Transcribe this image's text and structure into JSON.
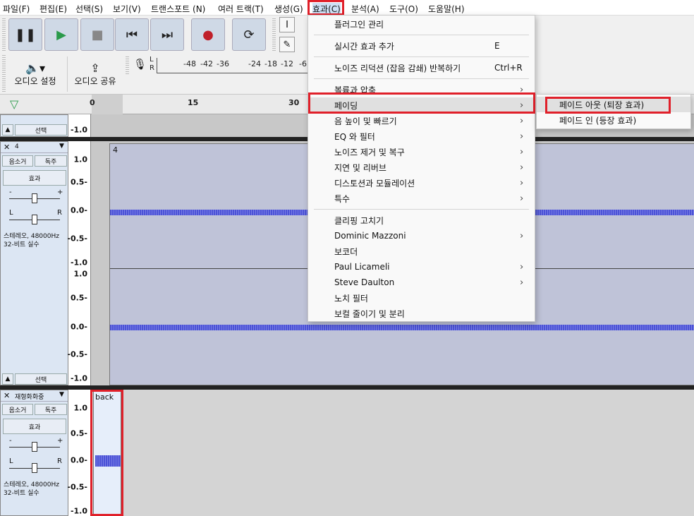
{
  "menubar": {
    "items": [
      "파일(F)",
      "편집(E)",
      "선택(S)",
      "보기(V)",
      "트랜스포트 (N)",
      "여러 트랙(T)",
      "생성(G)",
      "효과(C)",
      "분석(A)",
      "도구(O)",
      "도움말(H)"
    ]
  },
  "toolbar": {
    "pause_icon": "pause-icon",
    "play_icon": "play-icon",
    "stop_icon": "stop-icon",
    "skip_start_icon": "skip-start-icon",
    "skip_end_icon": "skip-end-icon",
    "record_icon": "record-icon",
    "loop_icon": "loop-icon",
    "audio_setup_label": "오디오 설정",
    "audio_share_label": "오디오 공유",
    "meter_ticks": [
      "-48",
      "-42",
      "-36",
      "-24",
      "-18",
      "-12",
      "-6"
    ],
    "meter_lr": [
      "L",
      "R"
    ]
  },
  "timeline": {
    "ticks": [
      "0",
      "15",
      "30"
    ]
  },
  "track1": {
    "name": "4",
    "mute": "음소거",
    "solo": "독주",
    "effects": "효과",
    "pan_l": "L",
    "pan_r": "R",
    "gain_minus": "-",
    "gain_plus": "+",
    "info_line1": "스테레오, 48000Hz",
    "info_line2": "32-비트 실수",
    "select": "선택",
    "clip_name": "4",
    "scale": [
      "1.0",
      "0.5-",
      "0.0-",
      "-0.5-",
      "-1.0"
    ]
  },
  "track_top": {
    "select": "선택",
    "scale_bottom": "-1.0"
  },
  "track2": {
    "name": "재형화화중",
    "mute": "음소거",
    "solo": "독주",
    "effects": "효과",
    "pan_l": "L",
    "pan_r": "R",
    "gain_minus": "-",
    "gain_plus": "+",
    "info_line1": "스테레오, 48000Hz",
    "info_line2": "32-비트 실수",
    "clip_name": "back",
    "scale": [
      "1.0",
      "0.5-",
      "0.0-",
      "-0.5-",
      "-1.0"
    ]
  },
  "effects_menu": {
    "items": [
      {
        "label": "플러그인 관리",
        "shortcut": "",
        "arrow": ""
      },
      {
        "label": "실시간 효과 추가",
        "shortcut": "E",
        "arrow": ""
      },
      {
        "label": "노이즈 리덕션 (잡음 감쇄) 반복하기",
        "shortcut": "Ctrl+R",
        "arrow": ""
      },
      {
        "label": "볼륨과 압축",
        "shortcut": "",
        "arrow": "›"
      },
      {
        "label": "페이딩",
        "shortcut": "",
        "arrow": "›"
      },
      {
        "label": "음 높이 및 빠르기",
        "shortcut": "",
        "arrow": "›"
      },
      {
        "label": "EQ 와 필터",
        "shortcut": "",
        "arrow": "›"
      },
      {
        "label": "노이즈 제거 및 복구",
        "shortcut": "",
        "arrow": "›"
      },
      {
        "label": "지연 및 리버브",
        "shortcut": "",
        "arrow": "›"
      },
      {
        "label": "디스토션과 모듈레이션",
        "shortcut": "",
        "arrow": "›"
      },
      {
        "label": "특수",
        "shortcut": "",
        "arrow": "›"
      },
      {
        "label": "클리핑 고치기",
        "shortcut": "",
        "arrow": ""
      },
      {
        "label": "Dominic Mazzoni",
        "shortcut": "",
        "arrow": "›"
      },
      {
        "label": "보코더",
        "shortcut": "",
        "arrow": ""
      },
      {
        "label": "Paul Licameli",
        "shortcut": "",
        "arrow": "›"
      },
      {
        "label": "Steve Daulton",
        "shortcut": "",
        "arrow": "›"
      },
      {
        "label": "노치 필터",
        "shortcut": "",
        "arrow": ""
      },
      {
        "label": "보컬 줄이기 및 분리",
        "shortcut": "",
        "arrow": ""
      }
    ]
  },
  "fading_submenu": {
    "items": [
      "페이드 아웃 (퇴장 효과)",
      "페이드 인 (등장 효과)"
    ]
  },
  "colors": {
    "highlight": "#e0202a",
    "wave": "#4b52d6",
    "accent": "#cfd9e6"
  }
}
